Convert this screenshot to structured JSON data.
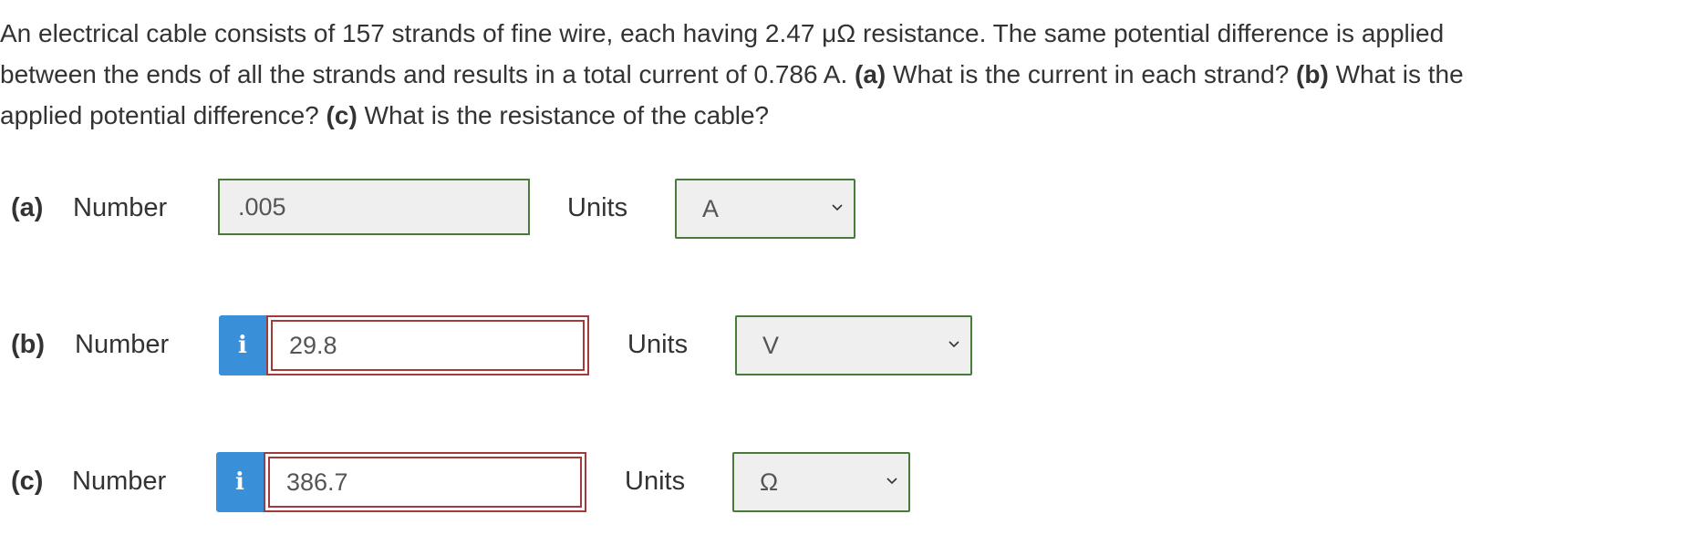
{
  "question": {
    "line1": "An electrical cable consists of 157 strands of fine wire, each having 2.47 μΩ resistance. The same potential difference is applied",
    "line2_a": "between the ends of all the strands and results in a total current of 0.786 A. ",
    "tag_a": "(a)",
    "line2_b": " What is the current in each strand? ",
    "tag_b": "(b)",
    "line2_c": " What is the",
    "line3_a": "applied potential difference? ",
    "tag_c": "(c)",
    "line3_b": " What is the resistance of the cable?"
  },
  "parts": [
    {
      "label": "(a)",
      "number_label": "Number",
      "value": ".005",
      "units_label": "Units",
      "unit": "A"
    },
    {
      "label": "(b)",
      "number_label": "Number",
      "info_icon": "i",
      "value": "29.8",
      "units_label": "Units",
      "unit": "V"
    },
    {
      "label": "(c)",
      "number_label": "Number",
      "info_icon": "i",
      "value": "386.7",
      "units_label": "Units",
      "unit": "Ω"
    }
  ],
  "colors": {
    "correct_border": "#4a7a3a",
    "incorrect_border": "#a33a3a",
    "info_button": "#3a8fd9"
  },
  "icons": {
    "info": "info-icon",
    "dropdown": "chevron-down-icon"
  }
}
